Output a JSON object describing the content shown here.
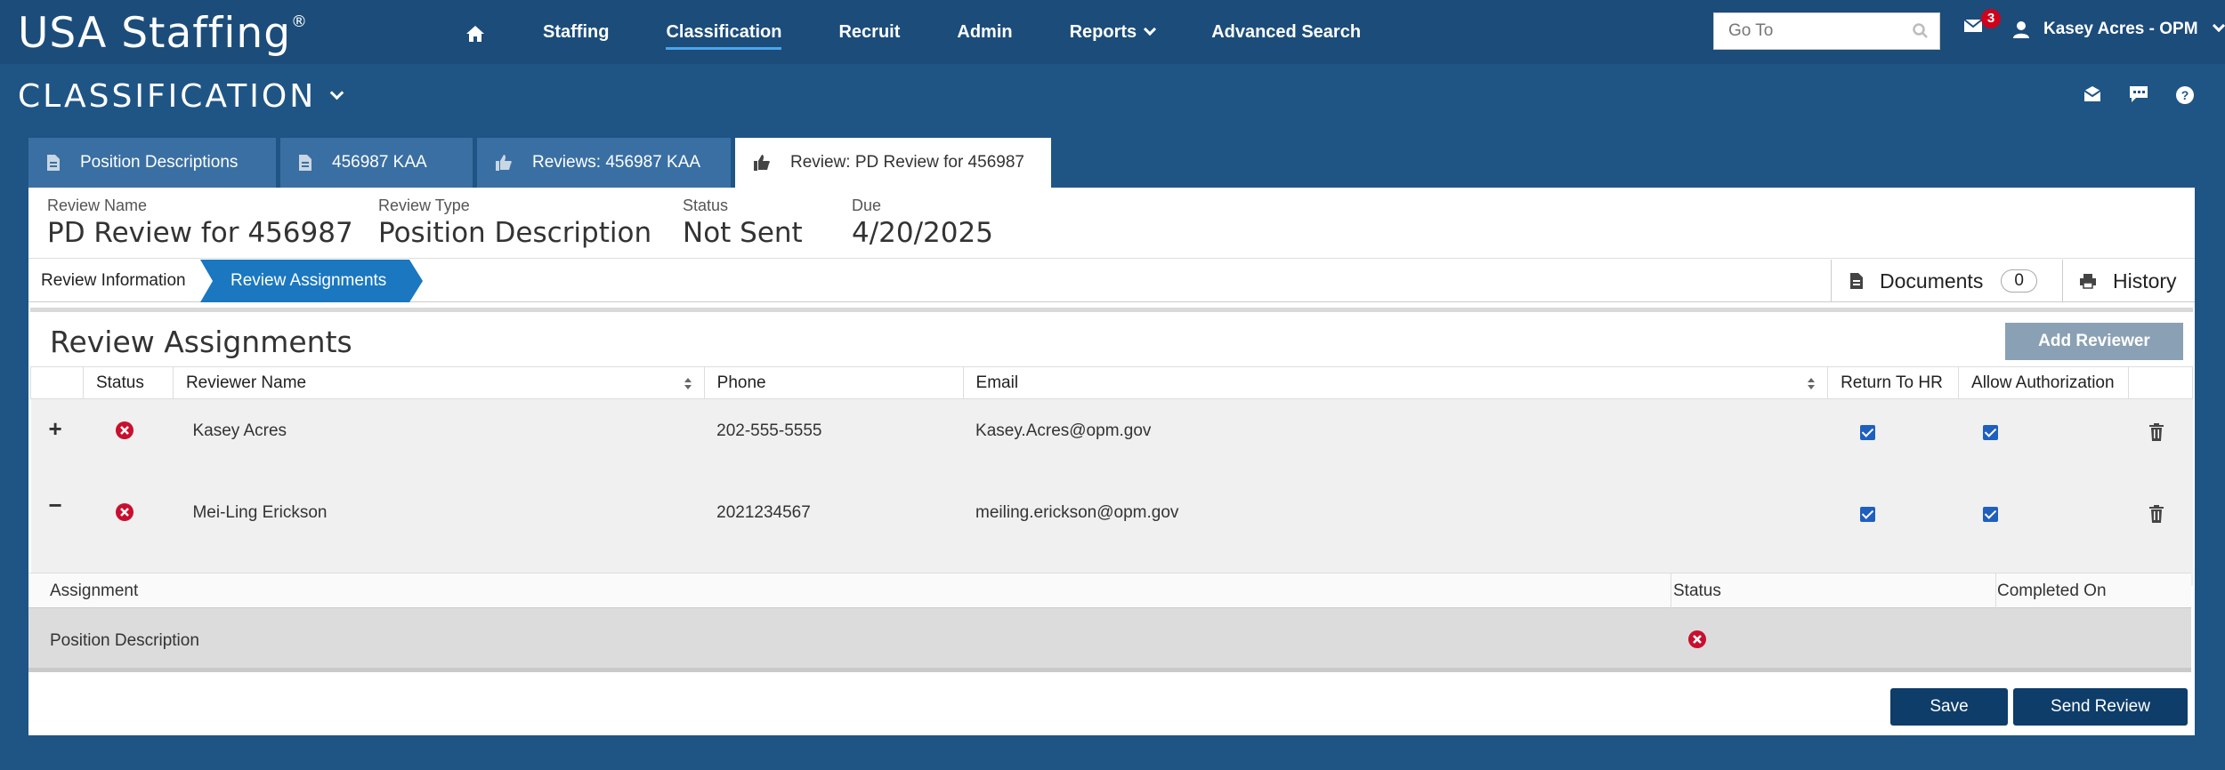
{
  "brand": {
    "name": "USA Staffing",
    "mark": "®"
  },
  "nav": {
    "items": [
      {
        "label": "Staffing"
      },
      {
        "label": "Classification"
      },
      {
        "label": "Recruit"
      },
      {
        "label": "Admin"
      },
      {
        "label": "Reports"
      },
      {
        "label": "Advanced Search"
      }
    ],
    "goto_placeholder": "Go To",
    "mail_count": "3",
    "user": "Kasey Acres - OPM"
  },
  "section": {
    "title": "CLASSIFICATION"
  },
  "tabs": [
    {
      "label": "Position Descriptions",
      "icon": "document-icon"
    },
    {
      "label": "456987 KAA",
      "icon": "document-icon"
    },
    {
      "label": "Reviews: 456987 KAA",
      "icon": "thumbs-up-icon"
    },
    {
      "label": "Review: PD Review for 456987",
      "icon": "thumbs-up-icon"
    }
  ],
  "summary": {
    "review_name_label": "Review Name",
    "review_name": "PD Review for 456987",
    "review_type_label": "Review Type",
    "review_type": "Position Description",
    "status_label": "Status",
    "status": "Not Sent",
    "due_label": "Due",
    "due": "4/20/2025"
  },
  "subnav": {
    "review_information": "Review Information",
    "review_assignments": "Review Assignments",
    "documents": "Documents",
    "documents_count": "0",
    "history": "History"
  },
  "assignments": {
    "title": "Review Assignments",
    "add_reviewer": "Add Reviewer",
    "columns": [
      "Status",
      "Reviewer Name",
      "Phone",
      "Email",
      "Return To HR",
      "Allow Authorization"
    ],
    "rows": [
      {
        "expander": "+",
        "name": "Kasey Acres",
        "phone": "202-555-5555",
        "email": "Kasey.Acres@opm.gov",
        "return_to_hr": true,
        "allow_authorization": true
      },
      {
        "expander": "−",
        "name": "Mei-Ling Erickson",
        "phone": "2021234567",
        "email": "meiling.erickson@opm.gov",
        "return_to_hr": true,
        "allow_authorization": true
      }
    ],
    "sub_columns": [
      "Assignment",
      "Status",
      "Completed On"
    ],
    "sub_rows": [
      {
        "assignment": "Position Description",
        "completed_on": ""
      }
    ]
  },
  "footer": {
    "save": "Save",
    "send_review": "Send Review"
  },
  "colors": {
    "header": "#1c4c7a",
    "background": "#1f5585",
    "tab": "#3a6fa3",
    "accent": "#1a77c0",
    "button": "#0e3d6a",
    "error": "#c8102e"
  }
}
